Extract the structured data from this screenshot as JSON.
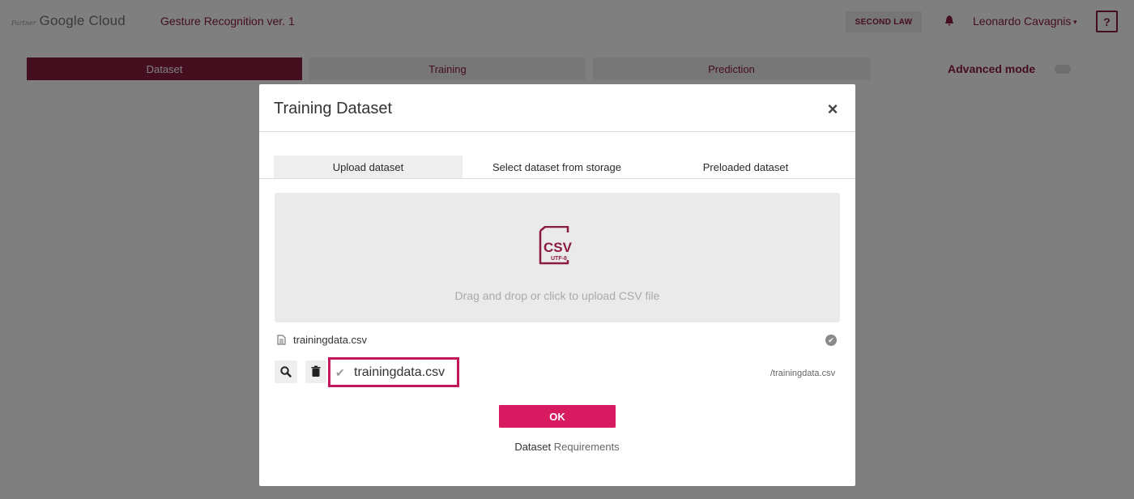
{
  "header": {
    "brand_prefix": "Partner",
    "brand_name": "Google Cloud",
    "project_title": "Gesture Recognition ver. 1",
    "second_law_label": "SECOND LAW",
    "user_name": "Leonardo Cavagnis",
    "help_label": "?"
  },
  "steps": [
    {
      "label": "Dataset",
      "active": true
    },
    {
      "label": "Training",
      "active": false
    },
    {
      "label": "Prediction",
      "active": false
    }
  ],
  "advanced": {
    "label": "Advanced mode"
  },
  "modal": {
    "title": "Training Dataset",
    "close": "×",
    "tabs": [
      {
        "label": "Upload dataset",
        "active": true
      },
      {
        "label": "Select dataset from storage",
        "active": false
      },
      {
        "label": "Preloaded dataset",
        "active": false
      }
    ],
    "dropzone": {
      "icon_text": "CSV",
      "icon_subtext": "UTF-8",
      "text": "Drag and drop or click to upload CSV file"
    },
    "uploaded_file": "trainingdata.csv",
    "selected_file": "trainingdata.csv",
    "file_path": "/trainingdata.csv",
    "ok_label": "OK",
    "requirements_a": "Dataset",
    "requirements_b": "Requirements"
  },
  "colors": {
    "brand": "#8b1c3d",
    "accent": "#d81b60",
    "highlight": "#c2185b"
  }
}
